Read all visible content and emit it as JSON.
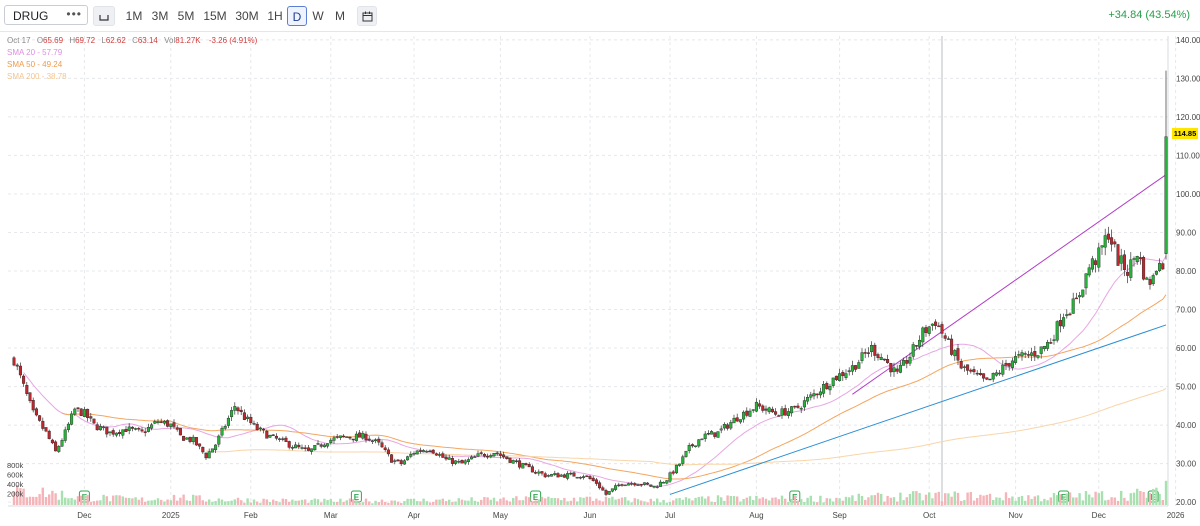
{
  "toolbar": {
    "symbol": "DRUG",
    "symbol_menu": "•••",
    "timeframes": [
      "1M",
      "3M",
      "5M",
      "15M",
      "30M",
      "1H",
      "D",
      "W",
      "M"
    ],
    "active_timeframe": "D",
    "change": "+34.84 (43.54%)"
  },
  "legend": {
    "date": "Oct 17",
    "open_label": "O",
    "open": "65.69",
    "high_label": "H",
    "high": "69.72",
    "low_label": "L",
    "low": "62.62",
    "close_label": "C",
    "close": "63.14",
    "vol_label": "Vol",
    "vol": "81.27K",
    "chg": "-3.26 (4.91%)",
    "sma20": "SMA 20 - 57.79",
    "sma50": "SMA 50 - 49.24",
    "sma200": "SMA 200 - 38.78"
  },
  "last_price": "114.85",
  "colors": {
    "up": "#26b33a",
    "down": "#c0262d",
    "sma20": "#e8a6e3",
    "sma50": "#f4a660",
    "sma200": "#f8d5a8",
    "trend_lower": "#2b8fd4",
    "trend_upper": "#b23fc7",
    "price_tag": "#ffe600"
  },
  "earnings_marker": "E",
  "chart_data": {
    "type": "candlestick",
    "y_ticks": [
      20,
      30,
      40,
      50,
      60,
      70,
      80,
      90,
      100,
      110,
      120,
      130,
      140
    ],
    "y_tick_labels": [
      "20.00",
      "30.00",
      "40.00",
      "50.00",
      "60.00",
      "70.00",
      "80.00",
      "90.00",
      "100.00",
      "110.00",
      "120.00",
      "130.00",
      "140.00"
    ],
    "ylim": [
      19,
      141
    ],
    "volume_ticks": [
      "800k",
      "600k",
      "400k",
      "200k"
    ],
    "x_labels": [
      "Dec",
      "2025",
      "Feb",
      "Mar",
      "Apr",
      "May",
      "Jun",
      "Jul",
      "Aug",
      "Sep",
      "Oct",
      "Nov",
      "Dec",
      "2026"
    ],
    "close_keypoints": [
      [
        0,
        57
      ],
      [
        3,
        50
      ],
      [
        6,
        43
      ],
      [
        10,
        38
      ],
      [
        13,
        33
      ],
      [
        16,
        38
      ],
      [
        19,
        44
      ],
      [
        22,
        43
      ],
      [
        25,
        40
      ],
      [
        30,
        38
      ],
      [
        35,
        39
      ],
      [
        40,
        38
      ],
      [
        45,
        41
      ],
      [
        49,
        40
      ],
      [
        52,
        37
      ],
      [
        56,
        36
      ],
      [
        60,
        32
      ],
      [
        63,
        35
      ],
      [
        66,
        40
      ],
      [
        69,
        45
      ],
      [
        72,
        42
      ],
      [
        76,
        39
      ],
      [
        80,
        37
      ],
      [
        86,
        35
      ],
      [
        92,
        33
      ],
      [
        98,
        36
      ],
      [
        104,
        37
      ],
      [
        110,
        37
      ],
      [
        114,
        35
      ],
      [
        118,
        31
      ],
      [
        121,
        30
      ],
      [
        125,
        33
      ],
      [
        130,
        34
      ],
      [
        135,
        31
      ],
      [
        140,
        30
      ],
      [
        145,
        32
      ],
      [
        150,
        33
      ],
      [
        155,
        31
      ],
      [
        160,
        29
      ],
      [
        166,
        27
      ],
      [
        172,
        27
      ],
      [
        178,
        27
      ],
      [
        182,
        25
      ],
      [
        185,
        22
      ],
      [
        190,
        25
      ],
      [
        195,
        25
      ],
      [
        200,
        24
      ],
      [
        204,
        26
      ],
      [
        208,
        30
      ],
      [
        211,
        34
      ],
      [
        215,
        37
      ],
      [
        220,
        38
      ],
      [
        226,
        42
      ],
      [
        232,
        45
      ],
      [
        238,
        43
      ],
      [
        244,
        44
      ],
      [
        250,
        48
      ],
      [
        256,
        52
      ],
      [
        262,
        55
      ],
      [
        268,
        60
      ],
      [
        272,
        57
      ],
      [
        276,
        53
      ],
      [
        280,
        58
      ],
      [
        284,
        64
      ],
      [
        288,
        67
      ],
      [
        292,
        61
      ],
      [
        296,
        55
      ],
      [
        300,
        53
      ],
      [
        304,
        51
      ],
      [
        308,
        54
      ],
      [
        312,
        57
      ],
      [
        316,
        58
      ],
      [
        320,
        59
      ],
      [
        324,
        62
      ],
      [
        328,
        69
      ],
      [
        332,
        72
      ],
      [
        336,
        81
      ],
      [
        339,
        84
      ],
      [
        342,
        90
      ],
      [
        345,
        83
      ],
      [
        348,
        80
      ],
      [
        351,
        85
      ],
      [
        354,
        77
      ],
      [
        356,
        78
      ],
      [
        358,
        84
      ],
      [
        359,
        80
      ],
      [
        360,
        114.85
      ]
    ],
    "volume_keypoints": [
      [
        0,
        0.3
      ],
      [
        10,
        0.28
      ],
      [
        20,
        0.18
      ],
      [
        30,
        0.15
      ],
      [
        40,
        0.12
      ],
      [
        50,
        0.18
      ],
      [
        60,
        0.13
      ],
      [
        70,
        0.12
      ],
      [
        80,
        0.1
      ],
      [
        100,
        0.09
      ],
      [
        120,
        0.1
      ],
      [
        140,
        0.11
      ],
      [
        160,
        0.13
      ],
      [
        180,
        0.14
      ],
      [
        200,
        0.1
      ],
      [
        220,
        0.14
      ],
      [
        240,
        0.14
      ],
      [
        260,
        0.15
      ],
      [
        280,
        0.2
      ],
      [
        300,
        0.2
      ],
      [
        320,
        0.17
      ],
      [
        340,
        0.22
      ],
      [
        360,
        0.26
      ]
    ],
    "earnings_days": [
      22,
      107,
      163,
      244,
      328,
      356
    ],
    "x_label_days": [
      22,
      49,
      74,
      99,
      125,
      152,
      180,
      205,
      232,
      258,
      286,
      313,
      339,
      363
    ],
    "vertical_marker_day": 290,
    "trendline_lower": [
      [
        205,
        22
      ],
      [
        360,
        66
      ]
    ],
    "trendline_upper": [
      [
        262,
        48
      ],
      [
        360,
        105
      ]
    ]
  }
}
